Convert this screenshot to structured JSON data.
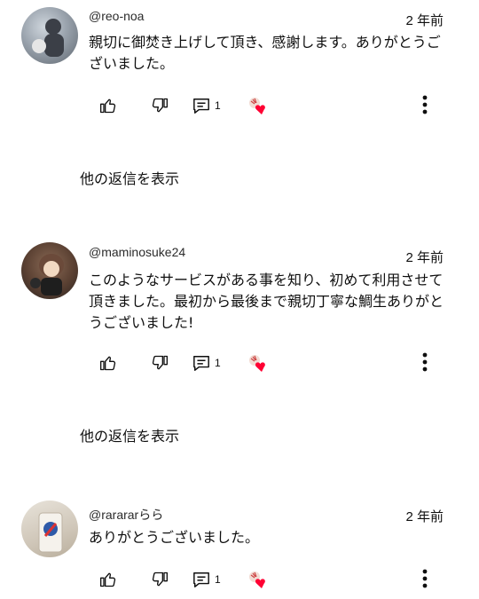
{
  "comments": [
    {
      "username": "@reo-noa",
      "time": "2 年前",
      "text": "親切に御焚き上げして頂き、感謝します。ありがとうございました。",
      "reply_count": "1",
      "show_replies": "他の返信を表示",
      "avatar_colors": [
        "#9aa3ad",
        "#3b3f47"
      ]
    },
    {
      "username": "@maminosuke24",
      "time": "2 年前",
      "text": "このようなサービスがある事を知り、初めて利用させて頂きました。最初から最後まで親切丁寧な鯛生ありがとうございました!",
      "reply_count": "1",
      "show_replies": "他の返信を表示",
      "avatar_colors": [
        "#6b4a3a",
        "#2a2320"
      ]
    },
    {
      "username": "@rarararらら",
      "time": "2 年前",
      "text": "ありがとうございました。",
      "reply_count": "1",
      "avatar_colors": [
        "#d9d2c6",
        "#2e5aa8"
      ]
    }
  ],
  "colors": {
    "heart": "#ff0033",
    "icon": "#0f0f0f"
  },
  "icons": [
    "thumb-up-icon",
    "thumb-down-icon",
    "reply-icon",
    "creator-heart-icon",
    "more-vert-icon"
  ]
}
